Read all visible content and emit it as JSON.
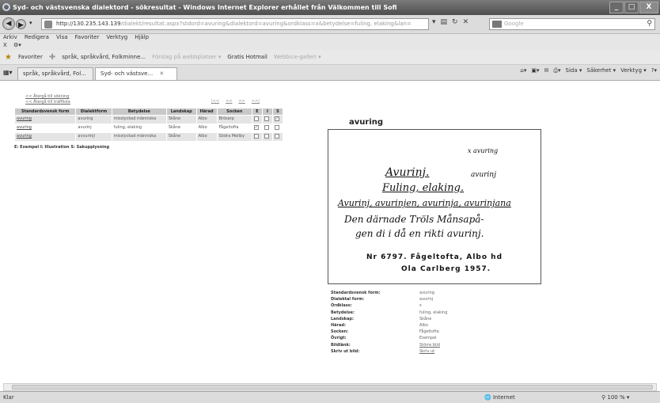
{
  "window": {
    "title": "Syd- och västsvenska dialektord - sökresultat - Windows Internet Explorer erhållet från Välkommen till Sofi",
    "minimize": "_",
    "maximize": "□",
    "close": "X"
  },
  "address": {
    "host": "http://130.235.143.139",
    "path": "/dialekt/resultat.aspx?stdord=avuring&dialektord=avuring&ordklass=x&betydelse=fuling, elaking&lan=",
    "search_placeholder": "Google"
  },
  "menu": [
    "Arkiv",
    "Redigera",
    "Visa",
    "Favoriter",
    "Verktyg",
    "Hjälp"
  ],
  "menu_row2": "X",
  "favorites": {
    "label": "Favoriter",
    "items": [
      {
        "label": "språk, språkvård, Folkminne...",
        "grey": false
      },
      {
        "label": "Förslag på webbplatser ▾",
        "grey": true
      },
      {
        "label": "Gratis Hotmail",
        "grey": false
      },
      {
        "label": "Webbice-galleri ▾",
        "grey": true
      }
    ]
  },
  "tabs": [
    {
      "label": "språk, språkvård, Fol...",
      "active": false
    },
    {
      "label": "Syd- och västsve...",
      "active": true
    }
  ],
  "commands": [
    "Sida ▾",
    "Säkerhet ▾",
    "Verktyg ▾"
  ],
  "page": {
    "links": [
      "<< Återgå till sökning",
      "<< Återgå till träfflista"
    ],
    "pager": [
      "|<<",
      "<<",
      ">>",
      ">>|"
    ],
    "table": {
      "headers": [
        "Standardsvensk form",
        "Dialektform",
        "Betydelse",
        "Landskap",
        "Härad",
        "Socken",
        "E",
        "I",
        "S"
      ],
      "rows": [
        {
          "std": "avuring",
          "dial": "avuring",
          "bet": "misslyckad människa",
          "land": "Skåne",
          "harad": "Albo",
          "socken": "Brösarp",
          "e": false,
          "i": false,
          "s": true,
          "selected": false
        },
        {
          "std": "avuring",
          "dial": "avurinj",
          "bet": "fuling, elaking",
          "land": "Skåne",
          "harad": "Albo",
          "socken": "Fågeltofta",
          "e": true,
          "i": false,
          "s": false,
          "selected": true
        },
        {
          "std": "avuring",
          "dial": "avvurinji",
          "bet": "misslyckad människa",
          "land": "Skåne",
          "harad": "Albo",
          "socken": "Södra Mellby",
          "e": false,
          "i": false,
          "s": false,
          "selected": false
        }
      ]
    },
    "legend": "E: Exempel I: Illustration S: Sakupplysning"
  },
  "detail": {
    "title": "avuring",
    "card": {
      "hw_top": "x avuring",
      "line1": "Avurinj.",
      "line1_suffix": "avurinj",
      "line2": "Fuling, elaking.",
      "line3": "Avurinj, avurinjen, avurinja, avurinjana",
      "line4": "Den därnade Tröls Månsapå-",
      "line5": "gen di i då en rikti avurinj.",
      "printed1": "Nr 6797. Fågeltofta, Albo hd",
      "printed2": "Ola Carlberg 1957."
    },
    "info": [
      {
        "label": "Standardsvensk form:",
        "value": "avuring",
        "link": false
      },
      {
        "label": "Dialektal form:",
        "value": "avurinj",
        "link": false
      },
      {
        "label": "Ordklass:",
        "value": "s",
        "link": false
      },
      {
        "label": "Betydelse:",
        "value": "fuling, elaking",
        "link": false
      },
      {
        "label": "Landskap:",
        "value": "Skåne",
        "link": false
      },
      {
        "label": "Härad:",
        "value": "Albo",
        "link": false
      },
      {
        "label": "Socken:",
        "value": "Fågeltofta",
        "link": false
      },
      {
        "label": "Övrigt:",
        "value": "Exempel",
        "link": false
      },
      {
        "label": "Bildlänk:",
        "value": "Större bild",
        "link": true
      },
      {
        "label": "Skriv ut bild:",
        "value": "Skriv ut",
        "link": true
      }
    ]
  },
  "status": {
    "left": "Klar",
    "zone": "Internet",
    "zoom": "100 %"
  }
}
